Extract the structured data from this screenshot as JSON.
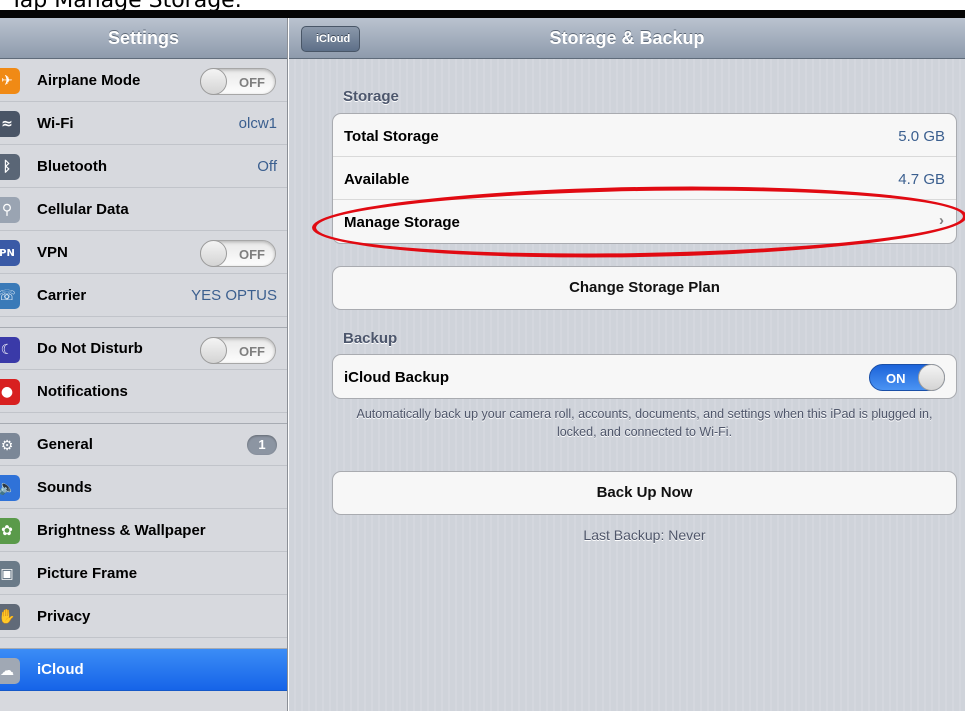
{
  "caption": "Tap Manage Storage.",
  "sidebar": {
    "title": "Settings",
    "items": [
      {
        "label": "Airplane Mode",
        "switch": "OFF",
        "icon": "airplane-icon",
        "color": "#f08a15"
      },
      {
        "label": "Wi-Fi",
        "value": "olcw1",
        "icon": "wifi-icon",
        "color": "#2f72d8"
      },
      {
        "label": "Bluetooth",
        "value": "Off",
        "icon": "bluetooth-icon",
        "color": "#3b74db"
      },
      {
        "label": "Cellular Data",
        "icon": "antenna-icon",
        "color": "#7b8797"
      },
      {
        "label": "VPN",
        "switch": "OFF",
        "icon": "vpn-icon",
        "color": "#3a5aa6"
      },
      {
        "label": "Carrier",
        "value": "YES OPTUS",
        "icon": "phone-icon",
        "color": "#3a9ad8"
      },
      {
        "label": "Do Not Disturb",
        "switch": "OFF",
        "icon": "moon-icon",
        "color": "#5a3aa8"
      },
      {
        "label": "Notifications",
        "icon": "notifications-icon",
        "color": "#d82020"
      },
      {
        "label": "General",
        "badge": "1",
        "icon": "gear-icon",
        "color": "#7b8797"
      },
      {
        "label": "Sounds",
        "icon": "speaker-icon",
        "color": "#2f72d8"
      },
      {
        "label": "Brightness & Wallpaper",
        "icon": "flower-icon",
        "color": "#e070a0"
      },
      {
        "label": "Picture Frame",
        "icon": "picture-frame-icon",
        "color": "#6a7a88"
      },
      {
        "label": "Privacy",
        "icon": "hand-icon",
        "color": "#606a78"
      },
      {
        "label": "iCloud",
        "icon": "cloud-icon",
        "color": "#a0a8b4",
        "selected": true
      }
    ]
  },
  "detail": {
    "back_label": "iCloud",
    "title": "Storage & Backup",
    "storage_header": "Storage",
    "total_label": "Total Storage",
    "total_value": "5.0 GB",
    "available_label": "Available",
    "available_value": "4.7 GB",
    "manage_label": "Manage Storage",
    "manage_chevron": "›",
    "change_plan_label": "Change Storage Plan",
    "backup_header": "Backup",
    "icloud_backup_label": "iCloud Backup",
    "icloud_backup_state": "ON",
    "backup_note": "Automatically back up your camera roll, accounts, documents, and settings when this iPad is plugged in, locked, and connected to Wi-Fi.",
    "backup_now_label": "Back Up Now",
    "last_backup": "Last Backup: Never"
  },
  "colors": {
    "highlight": "#e10a12",
    "selected": "#1f6ff0",
    "value_text": "#3b5f8f"
  }
}
